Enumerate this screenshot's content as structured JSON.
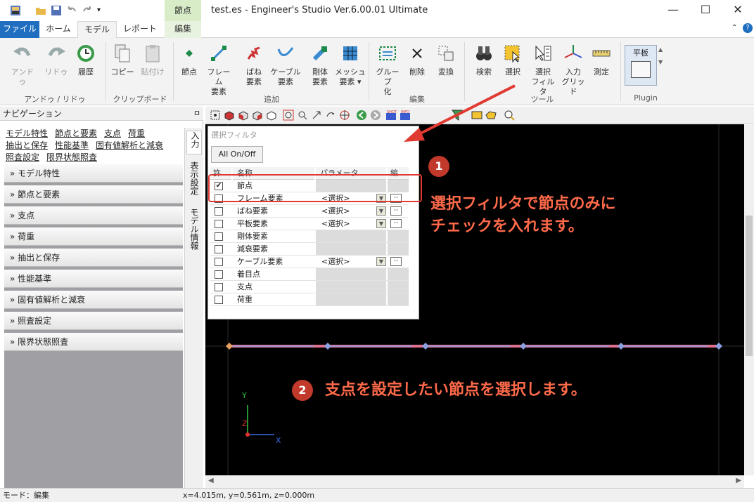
{
  "titlebar": {
    "context_tab_header": "節点",
    "title": "test.es - Engineer's Studio Ver.6.00.01 Ultimate",
    "minimize": "—",
    "maximize": "☐",
    "close": "✕"
  },
  "ribbon_tabs": {
    "file": "ファイル",
    "home": "ホーム",
    "model": "モデル",
    "report": "レポート",
    "edit": "編集"
  },
  "ribbon": {
    "undo": "アンドゥ",
    "redo": "リドゥ",
    "history": "履歴",
    "group_undo": "アンドゥ / リドゥ",
    "copy": "コピー",
    "paste": "貼付け",
    "group_clipboard": "クリップボード",
    "node": "節点",
    "frame_l1": "フレーム",
    "frame_l2": "要素",
    "spring_l1": "ばね",
    "spring_l2": "要素",
    "cable_l1": "ケーブル",
    "cable_l2": "要素",
    "rigid_l1": "剛体",
    "rigid_l2": "要素",
    "mesh_l1": "メッシュ",
    "mesh_l2": "要素 ▾",
    "group_add": "追加",
    "group_l1": "グループ",
    "group_l2": "化",
    "delete": "削除",
    "transform": "変換",
    "group_edit": "編集",
    "search": "検索",
    "select": "選択",
    "selfilter_l1": "選択",
    "selfilter_l2": "フィルタ",
    "input_grid_l1": "入力",
    "input_grid_l2": "グリッド",
    "measure": "測定",
    "group_tools": "ツール",
    "plate": "平板",
    "group_plugin": "Plugin"
  },
  "nav": {
    "title": "ナビゲーション",
    "pin": "ㅁ",
    "links_row1": [
      "モデル特性",
      "節点と要素",
      "支点",
      "荷重"
    ],
    "links_row2": [
      "抽出と保存",
      "性能基準",
      "固有値解析と減衰"
    ],
    "links_row3": [
      "照査設定",
      "限界状態照査"
    ],
    "sections": [
      "モデル特性",
      "節点と要素",
      "支点",
      "荷重",
      "抽出と保存",
      "性能基準",
      "固有値解析と減衰",
      "照査設定",
      "限界状態照査"
    ],
    "vtab_input": "入力",
    "vtab_display": "表示設定",
    "vtab_model": "モデル情報"
  },
  "filter": {
    "title": "選択フィルタ",
    "all_onoff": "All On/Off",
    "col_check": "許…",
    "col_name": "名称",
    "col_param": "パラメータ",
    "col_edit": "編…",
    "rows": [
      {
        "name": "節点",
        "checked": "✔",
        "param": ""
      },
      {
        "name": "フレーム要素",
        "checked": "",
        "param": "<選択>"
      },
      {
        "name": "ばね要素",
        "checked": "",
        "param": "<選択>"
      },
      {
        "name": "平板要素",
        "checked": "",
        "param": "<選択>"
      },
      {
        "name": "剛体要素",
        "checked": "",
        "param": ""
      },
      {
        "name": "減衰要素",
        "checked": "",
        "param": ""
      },
      {
        "name": "ケーブル要素",
        "checked": "",
        "param": "<選択>"
      },
      {
        "name": "着目点",
        "checked": "",
        "param": ""
      },
      {
        "name": "支点",
        "checked": "",
        "param": ""
      },
      {
        "name": "荷重",
        "checked": "",
        "param": ""
      }
    ]
  },
  "annotations": {
    "badge1": "1",
    "text1_line1": "選択フィルタで節点のみに",
    "text1_line2": "チェックを入れます。",
    "badge2": "2",
    "text2": "支点を設定したい節点を選択します。"
  },
  "axes": {
    "y": "Y",
    "z": "Z",
    "x": "X"
  },
  "status": {
    "mode": "モード：編集",
    "coords": "x=4.015m, y=0.561m, z=0.000m"
  },
  "colors": {
    "file_tab": "#1f6ec0",
    "annotation": "#ff6a4a",
    "badge": "#c0392b",
    "beam": "#e0708f",
    "node": "#8aa0e0"
  }
}
